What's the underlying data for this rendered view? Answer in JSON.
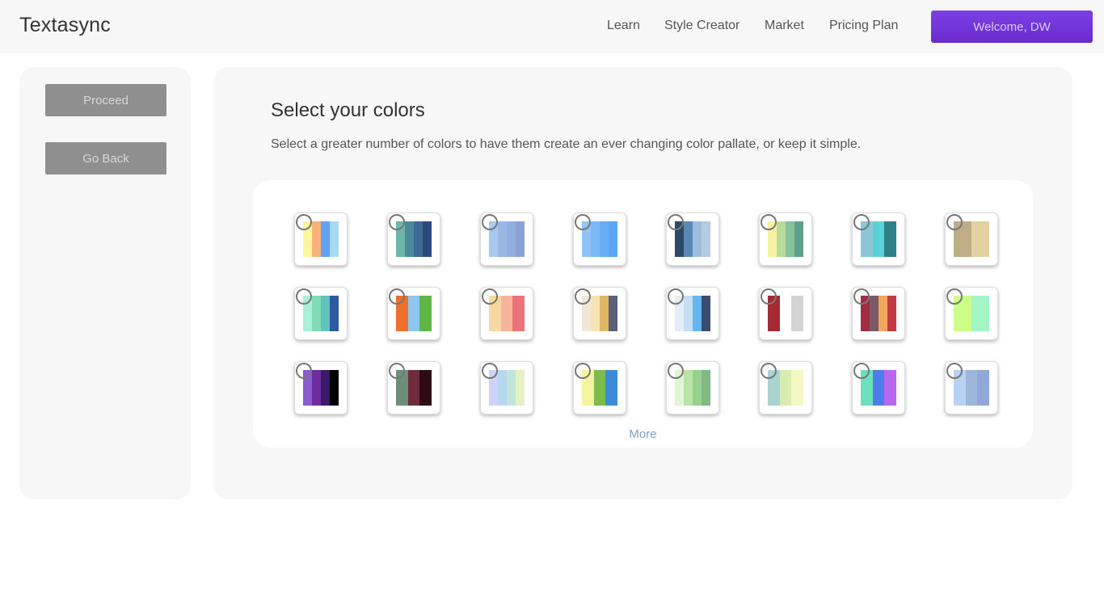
{
  "header": {
    "brand": "Textasync",
    "nav": [
      "Learn",
      "Style Creator",
      "Market",
      "Pricing Plan"
    ],
    "welcome": "Welcome, DW"
  },
  "sidebar": {
    "proceed": "Proceed",
    "go_back": "Go Back"
  },
  "main": {
    "title": "Select your colors",
    "subtitle": "Select a greater number of colors to have them create an ever changing color pallate, or keep it simple.",
    "more": "More",
    "palettes": [
      [
        "#fff59d",
        "#f7b27a",
        "#5fa1f7",
        "#a5d8f3"
      ],
      [
        "#6cb8a8",
        "#4a8a9a",
        "#3d6a94",
        "#2c4a7c"
      ],
      [
        "#a9c8ee",
        "#9ab7e4",
        "#93aee0",
        "#8aa3d4"
      ],
      [
        "#8ec4f7",
        "#7ab9f6",
        "#68adf6",
        "#5ba5f5"
      ],
      [
        "#2e4966",
        "#5b89b6",
        "#9bbde0",
        "#b4cbe3"
      ],
      [
        "#f7f3a1",
        "#b7dc9a",
        "#86c19a",
        "#5fa08d"
      ],
      [
        "#8cc6d6",
        "#58d2d6",
        "#2f7f86"
      ],
      [
        "#bfad87",
        "#e2d2a3"
      ],
      [
        "#a8f0d8",
        "#81dcb6",
        "#5fc4bd",
        "#2f5aa1"
      ],
      [
        "#ef6f2d",
        "#8cc7f2",
        "#5fb545"
      ],
      [
        "#f6d7a0",
        "#f6b49b",
        "#ec7479"
      ],
      [
        "#efe6d4",
        "#f6e4b7",
        "#e0b665",
        "#58607a"
      ],
      [
        "#e5edf5",
        "#c5def1",
        "#64b6ef",
        "#3a4c71"
      ],
      [
        "#a52a33",
        "#ffffff",
        "#d4d4d4"
      ],
      [
        "#a32b44",
        "#7b5a6a",
        "#f1a85a",
        "#c43a44"
      ],
      [
        "#ccff88",
        "#a4f5c6"
      ],
      [
        "#8a5bd1",
        "#6e2c9c",
        "#3a1a6d",
        "#000000"
      ],
      [
        "#6b8f78",
        "#6d2b3c",
        "#2e0c14"
      ],
      [
        "#cdd3f7",
        "#b6d7ee",
        "#c2e5da",
        "#e5f0c5"
      ],
      [
        "#f7f29f",
        "#7dbb4d",
        "#3b8bd8"
      ],
      [
        "#e0f5d3",
        "#b9e3a7",
        "#99d08d",
        "#80b986"
      ],
      [
        "#a9d3d1",
        "#d8ebb0",
        "#f5f7c4"
      ],
      [
        "#6be0bd",
        "#4f7be8",
        "#b868f0"
      ],
      [
        "#b8d2f1",
        "#9db6da",
        "#90a9d4"
      ]
    ]
  }
}
